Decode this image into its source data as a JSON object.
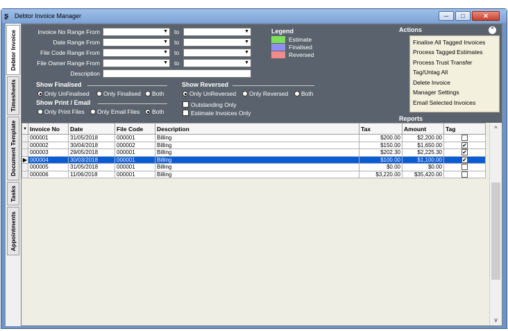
{
  "window": {
    "title": "Debtor Invoice Manager",
    "min_glyph": "─",
    "max_glyph": "□",
    "close_glyph": "✕",
    "app_glyph": "ʂ"
  },
  "vertical_tabs": [
    {
      "label": "Debtor Invoice"
    },
    {
      "label": "Timesheets"
    },
    {
      "label": "Document Template"
    },
    {
      "label": "Tasks"
    },
    {
      "label": "Appointments"
    }
  ],
  "filters": {
    "invoice_no_label": "Invoice No Range From",
    "date_range_label": "Date Range From",
    "file_code_label": "File Code Range From",
    "file_owner_label": "File Owner Range From",
    "description_label": "Description",
    "to_label": "to",
    "dropdown_glyph": "▼"
  },
  "legend": {
    "title": "Legend",
    "items": [
      {
        "label": "Estimate",
        "color": "#7ee05a"
      },
      {
        "label": "Finalised",
        "color": "#8f8ff0"
      },
      {
        "label": "Reversed",
        "color": "#f08b8b"
      }
    ]
  },
  "show_finalised": {
    "title": "Show Finalised",
    "options": [
      "Only UnFinalised",
      "Only Finalised",
      "Both"
    ],
    "selected": 0
  },
  "show_reversed": {
    "title": "Show Reversed",
    "options": [
      "Only UnReversed",
      "Only Reversed",
      "Both"
    ],
    "selected": 0
  },
  "show_print_email": {
    "title": "Show Print / Email",
    "options": [
      "Only Print Files",
      "Only Email Files",
      "Both"
    ],
    "selected": 2
  },
  "checks": {
    "outstanding_only": "Outstanding Only",
    "estimate_only": "Estimate Invoices Only"
  },
  "actions": {
    "title": "Actions",
    "collapse_glyph": "⌃",
    "items": [
      "Finalise All Tagged Invoices",
      "Process Tagged Estimates",
      "Process Trust Transfer",
      "Tag/Untag All",
      "Delete Invoice",
      "Manager Settings",
      "Email Selected Invoices"
    ]
  },
  "reports": {
    "title": "Reports"
  },
  "grid": {
    "sort_glyph": "▼",
    "row_pointer_glyph": "▶",
    "check_glyph": "✔",
    "scroll_up_glyph": "^",
    "scroll_down_glyph": "v",
    "columns": [
      "Invoice No",
      "Date",
      "File Code",
      "Description",
      "Tax",
      "Amount",
      "Tag"
    ],
    "rows": [
      {
        "invoice": "000001",
        "date": "31/05/2018",
        "file_code": "000001",
        "description": "Billing",
        "tax": "$200.00",
        "amount": "$2,200.00",
        "tag": false
      },
      {
        "invoice": "000002",
        "date": "30/04/2018",
        "file_code": "000002",
        "description": "Billing",
        "tax": "$150.00",
        "amount": "$1,650.00",
        "tag": true
      },
      {
        "invoice": "000003",
        "date": "29/05/2018",
        "file_code": "000001",
        "description": "Billing",
        "tax": "$202.30",
        "amount": "$2,225.30",
        "tag": true
      },
      {
        "invoice": "000004",
        "date": "30/03/2018",
        "file_code": "000001",
        "description": "Billing",
        "tax": "$100.00",
        "amount": "$1,100.00",
        "tag": true
      },
      {
        "invoice": "000005",
        "date": "31/05/2018",
        "file_code": "000001",
        "description": "Billing",
        "tax": "$0.00",
        "amount": "$0.00",
        "tag": false
      },
      {
        "invoice": "000006",
        "date": "11/06/2018",
        "file_code": "000001",
        "description": "Billing",
        "tax": "$3,220.00",
        "amount": "$35,420.00",
        "tag": false
      }
    ],
    "selected_row": 3
  }
}
